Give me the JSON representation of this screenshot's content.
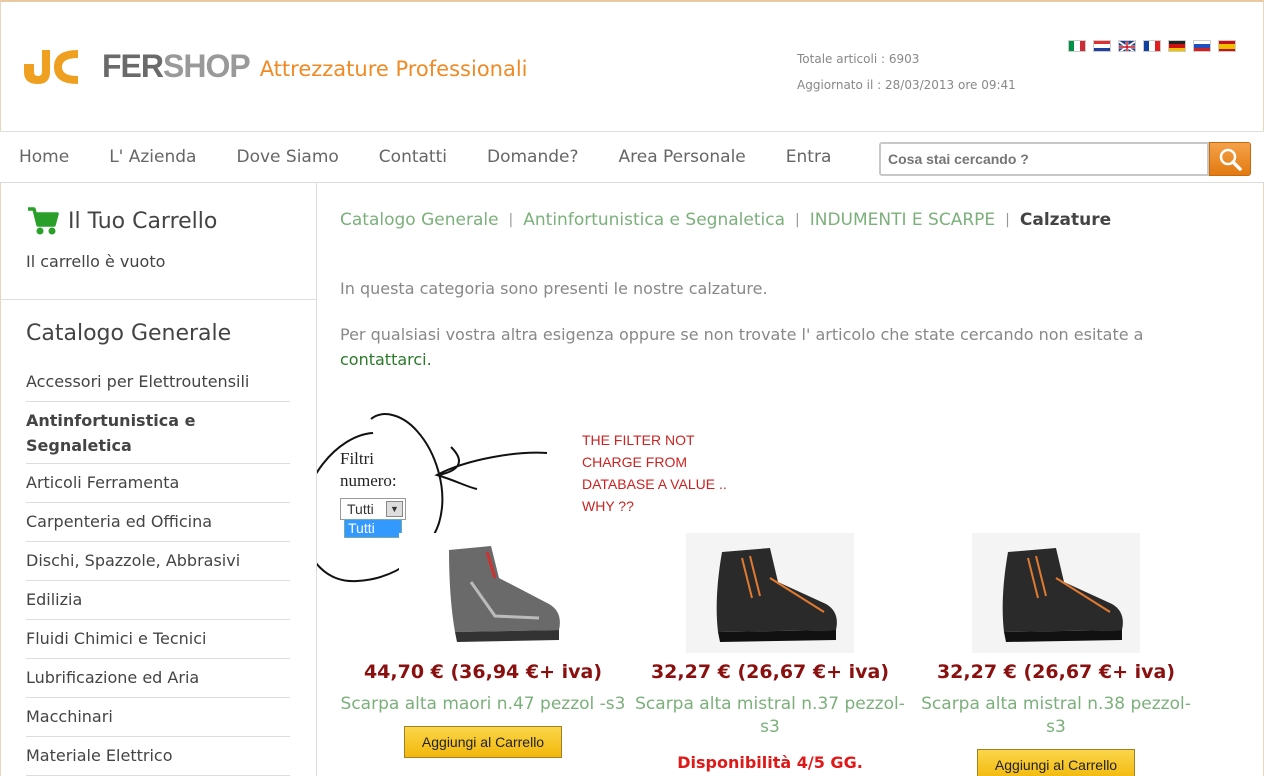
{
  "header": {
    "logo_fer": "FER",
    "logo_shop": "SHOP",
    "tagline": "Attrezzature Professionali",
    "total_articles": "Totale articoli : 6903",
    "updated": "Aggiornato il : 28/03/2013 ore 09:41",
    "flags": [
      "flag-it-icon",
      "flag-hr-icon",
      "flag-uk-icon",
      "flag-fr-icon",
      "flag-de-icon",
      "flag-ru-icon",
      "flag-es-icon"
    ]
  },
  "nav": {
    "items": [
      "Home",
      "L' Azienda",
      "Dove Siamo",
      "Contatti",
      "Domande?",
      "Area Personale",
      "Entra"
    ],
    "search_placeholder": "Cosa stai cercando ?"
  },
  "sidebar": {
    "cart_title": "Il Tuo Carrello",
    "cart_empty": "Il carrello è vuoto",
    "catalog_title": "Catalogo Generale",
    "categories": [
      "Accessori per Elettroutensili",
      "Antinfortunistica e Segnaletica",
      "Articoli Ferramenta",
      "Carpenteria ed Officina",
      "Dischi, Spazzole, Abbrasivi",
      "Edilizia",
      "Fluidi Chimici e Tecnici",
      "Lubrificazione ed Aria",
      "Macchinari",
      "Materiale Elettrico"
    ]
  },
  "breadcrumb": [
    "Catalogo Generale",
    "Antinfortunistica e Segnaletica",
    "INDUMENTI E SCARPE",
    "Calzature"
  ],
  "main": {
    "intro": "In questa categoria sono presenti le nostre calzature.",
    "intro2": "Per qualsiasi vostra altra esigenza oppure se non trovate l' articolo che state cercando non esitate a",
    "contact_link": "contattarci."
  },
  "filter": {
    "label1": "Filtri",
    "label2": "numero:",
    "selected": "Tutti",
    "option": "Tutti"
  },
  "annotation": [
    "THE FILTER NOT",
    "CHARGE FROM",
    "DATABASE A VALUE ..",
    "WHY ??"
  ],
  "products": [
    {
      "price": "44,70 € (36,94 €+ iva)",
      "name": "Scarpa alta maori n.47 pezzol -s3",
      "action": "Aggiungi al Carrello"
    },
    {
      "price": "32,27 € (26,67 €+ iva)",
      "name": "Scarpa alta mistral n.37 pezzol-s3",
      "availability": "Disponibilità 4/5 GG."
    },
    {
      "price": "32,27 € (26,67 €+ iva)",
      "name": "Scarpa alta mistral n.38 pezzol-s3",
      "action": "Aggiungi al Carrello"
    }
  ],
  "colors": {
    "accent": "#f08a24",
    "link": "#7bb07b",
    "price": "#8a1010",
    "annotation": "#cc2222"
  }
}
